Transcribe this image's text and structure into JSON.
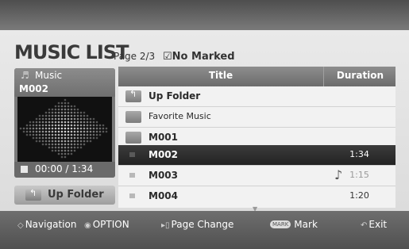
{
  "header": {
    "title": "MUSIC LIST",
    "page": "Page 2/3",
    "marked": "No Marked"
  },
  "preview": {
    "category": "Music",
    "file": "M002",
    "time": "00:00 / 1:34",
    "up_folder_label": "Up Folder"
  },
  "list": {
    "col_title": "Title",
    "col_duration": "Duration",
    "rows": [
      {
        "name": "Up Folder",
        "duration": ""
      },
      {
        "name": "Favorite Music",
        "duration": ""
      },
      {
        "name": "M001",
        "duration": ""
      },
      {
        "name": "M002",
        "duration": "1:34"
      },
      {
        "name": "M003",
        "duration": "1:15"
      },
      {
        "name": "M004",
        "duration": "1:20"
      }
    ]
  },
  "footer": {
    "navigation": "Navigation",
    "option": "OPTION",
    "page_change": "Page Change",
    "mark_key": "MARK",
    "mark": "Mark",
    "exit": "Exit"
  }
}
